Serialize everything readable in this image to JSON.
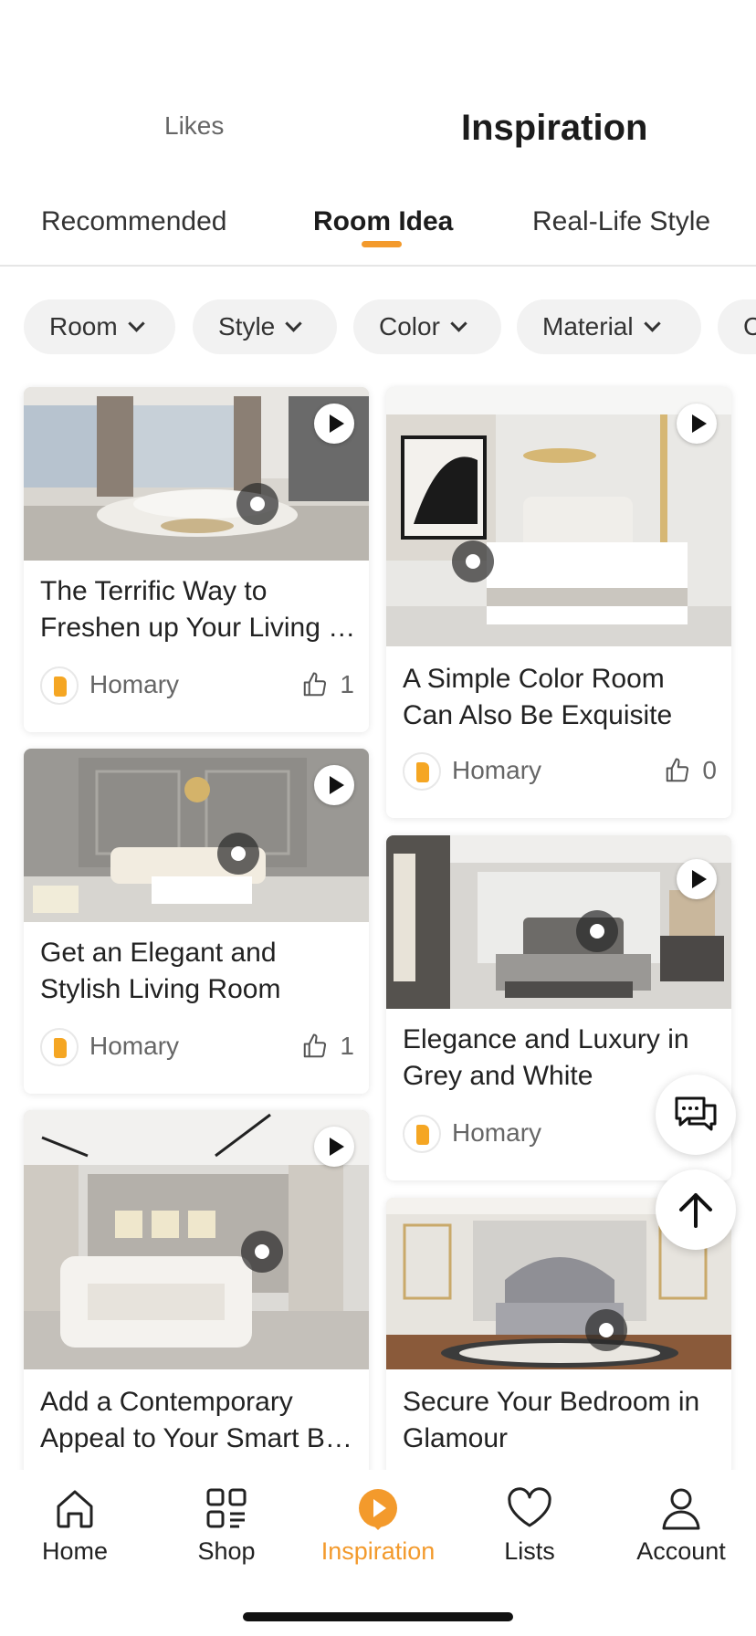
{
  "header": {
    "tabs": [
      {
        "label": "Likes"
      },
      {
        "label": "Inspiration",
        "active": true
      }
    ]
  },
  "subtabs": [
    {
      "label": "Recommended"
    },
    {
      "label": "Room Idea",
      "active": true
    },
    {
      "label": "Real-Life Style"
    }
  ],
  "filters": [
    {
      "label": "Room"
    },
    {
      "label": "Style"
    },
    {
      "label": "Color"
    },
    {
      "label": "Material"
    },
    {
      "label": "C"
    }
  ],
  "cards": [
    {
      "title_lines": [
        "The Terrific Way to",
        "Freshen up Your Living Room"
      ],
      "author": "Homary",
      "likes": "1",
      "image": "modern living room with curved sofa and city view"
    },
    {
      "title_lines": [
        "Get an Elegant and",
        "Stylish Living Room"
      ],
      "author": "Homary",
      "likes": "1",
      "image": "grey panelled living room with cream sofa"
    },
    {
      "title_lines": [
        "Add a Contemporary",
        "Appeal to Your Smart Bedroom"
      ],
      "author": "Homary",
      "likes": "",
      "image": "contemporary bedroom with white smart bed"
    },
    {
      "title_lines": [
        "A Simple Color Room",
        "Can Also Be Exquisite"
      ],
      "author": "Homary",
      "likes": "0",
      "image": "white bedroom with abstract wall art"
    },
    {
      "title_lines": [
        "Elegance and Luxury in",
        "Grey and White"
      ],
      "author": "Homary",
      "likes": "",
      "image": "grey and white luxury bedroom"
    },
    {
      "title_lines": [
        "Secure Your Bedroom in",
        "Glamour"
      ],
      "author": "Homary",
      "likes": "",
      "image": "glamorous bedroom with tufted grey bed"
    }
  ],
  "floating": {
    "chat_icon": "chat-icon",
    "top_icon": "arrow-up-icon"
  },
  "nav": [
    {
      "label": "Home",
      "icon": "home-icon"
    },
    {
      "label": "Shop",
      "icon": "shop-icon"
    },
    {
      "label": "Inspiration",
      "icon": "inspiration-icon",
      "active": true
    },
    {
      "label": "Lists",
      "icon": "heart-icon"
    },
    {
      "label": "Account",
      "icon": "account-icon"
    }
  ],
  "colors": {
    "accent": "#f39a2c",
    "text": "#222222",
    "chip_bg": "#f2f2f2"
  }
}
